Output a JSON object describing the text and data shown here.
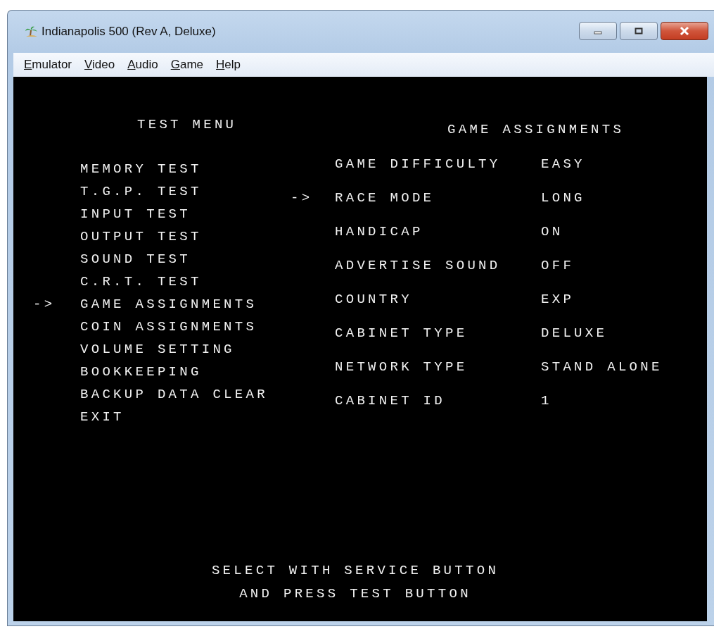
{
  "window": {
    "title": "Indianapolis 500 (Rev A, Deluxe)"
  },
  "menu_bar": [
    "Emulator",
    "Video",
    "Audio",
    "Game",
    "Help"
  ],
  "test_menu": {
    "title": "TEST MENU",
    "cursor": "->",
    "items": [
      {
        "label": "MEMORY TEST",
        "selected": false
      },
      {
        "label": "T.G.P. TEST",
        "selected": false
      },
      {
        "label": "INPUT TEST",
        "selected": false
      },
      {
        "label": "OUTPUT TEST",
        "selected": false
      },
      {
        "label": "SOUND TEST",
        "selected": false
      },
      {
        "label": "C.R.T. TEST",
        "selected": false
      },
      {
        "label": "GAME ASSIGNMENTS",
        "selected": true
      },
      {
        "label": "COIN ASSIGNMENTS",
        "selected": false
      },
      {
        "label": "VOLUME SETTING",
        "selected": false
      },
      {
        "label": "BOOKKEEPING",
        "selected": false
      },
      {
        "label": "BACKUP DATA CLEAR",
        "selected": false
      },
      {
        "label": "EXIT",
        "selected": false
      }
    ]
  },
  "game_assignments": {
    "title": "GAME ASSIGNMENTS",
    "cursor": "->",
    "settings": [
      {
        "label": "GAME DIFFICULTY",
        "value": "EASY",
        "selected": false
      },
      {
        "label": "RACE MODE",
        "value": "LONG",
        "selected": true
      },
      {
        "label": "HANDICAP",
        "value": "ON",
        "selected": false
      },
      {
        "label": "ADVERTISE SOUND",
        "value": "OFF",
        "selected": false
      },
      {
        "label": "COUNTRY",
        "value": "EXP",
        "selected": false
      },
      {
        "label": "CABINET TYPE",
        "value": "DELUXE",
        "selected": false
      },
      {
        "label": "NETWORK TYPE",
        "value": "STAND ALONE",
        "selected": false
      },
      {
        "label": "CABINET ID",
        "value": "1",
        "selected": false
      }
    ]
  },
  "footer": [
    "SELECT WITH SERVICE BUTTON",
    "AND PRESS TEST BUTTON"
  ]
}
